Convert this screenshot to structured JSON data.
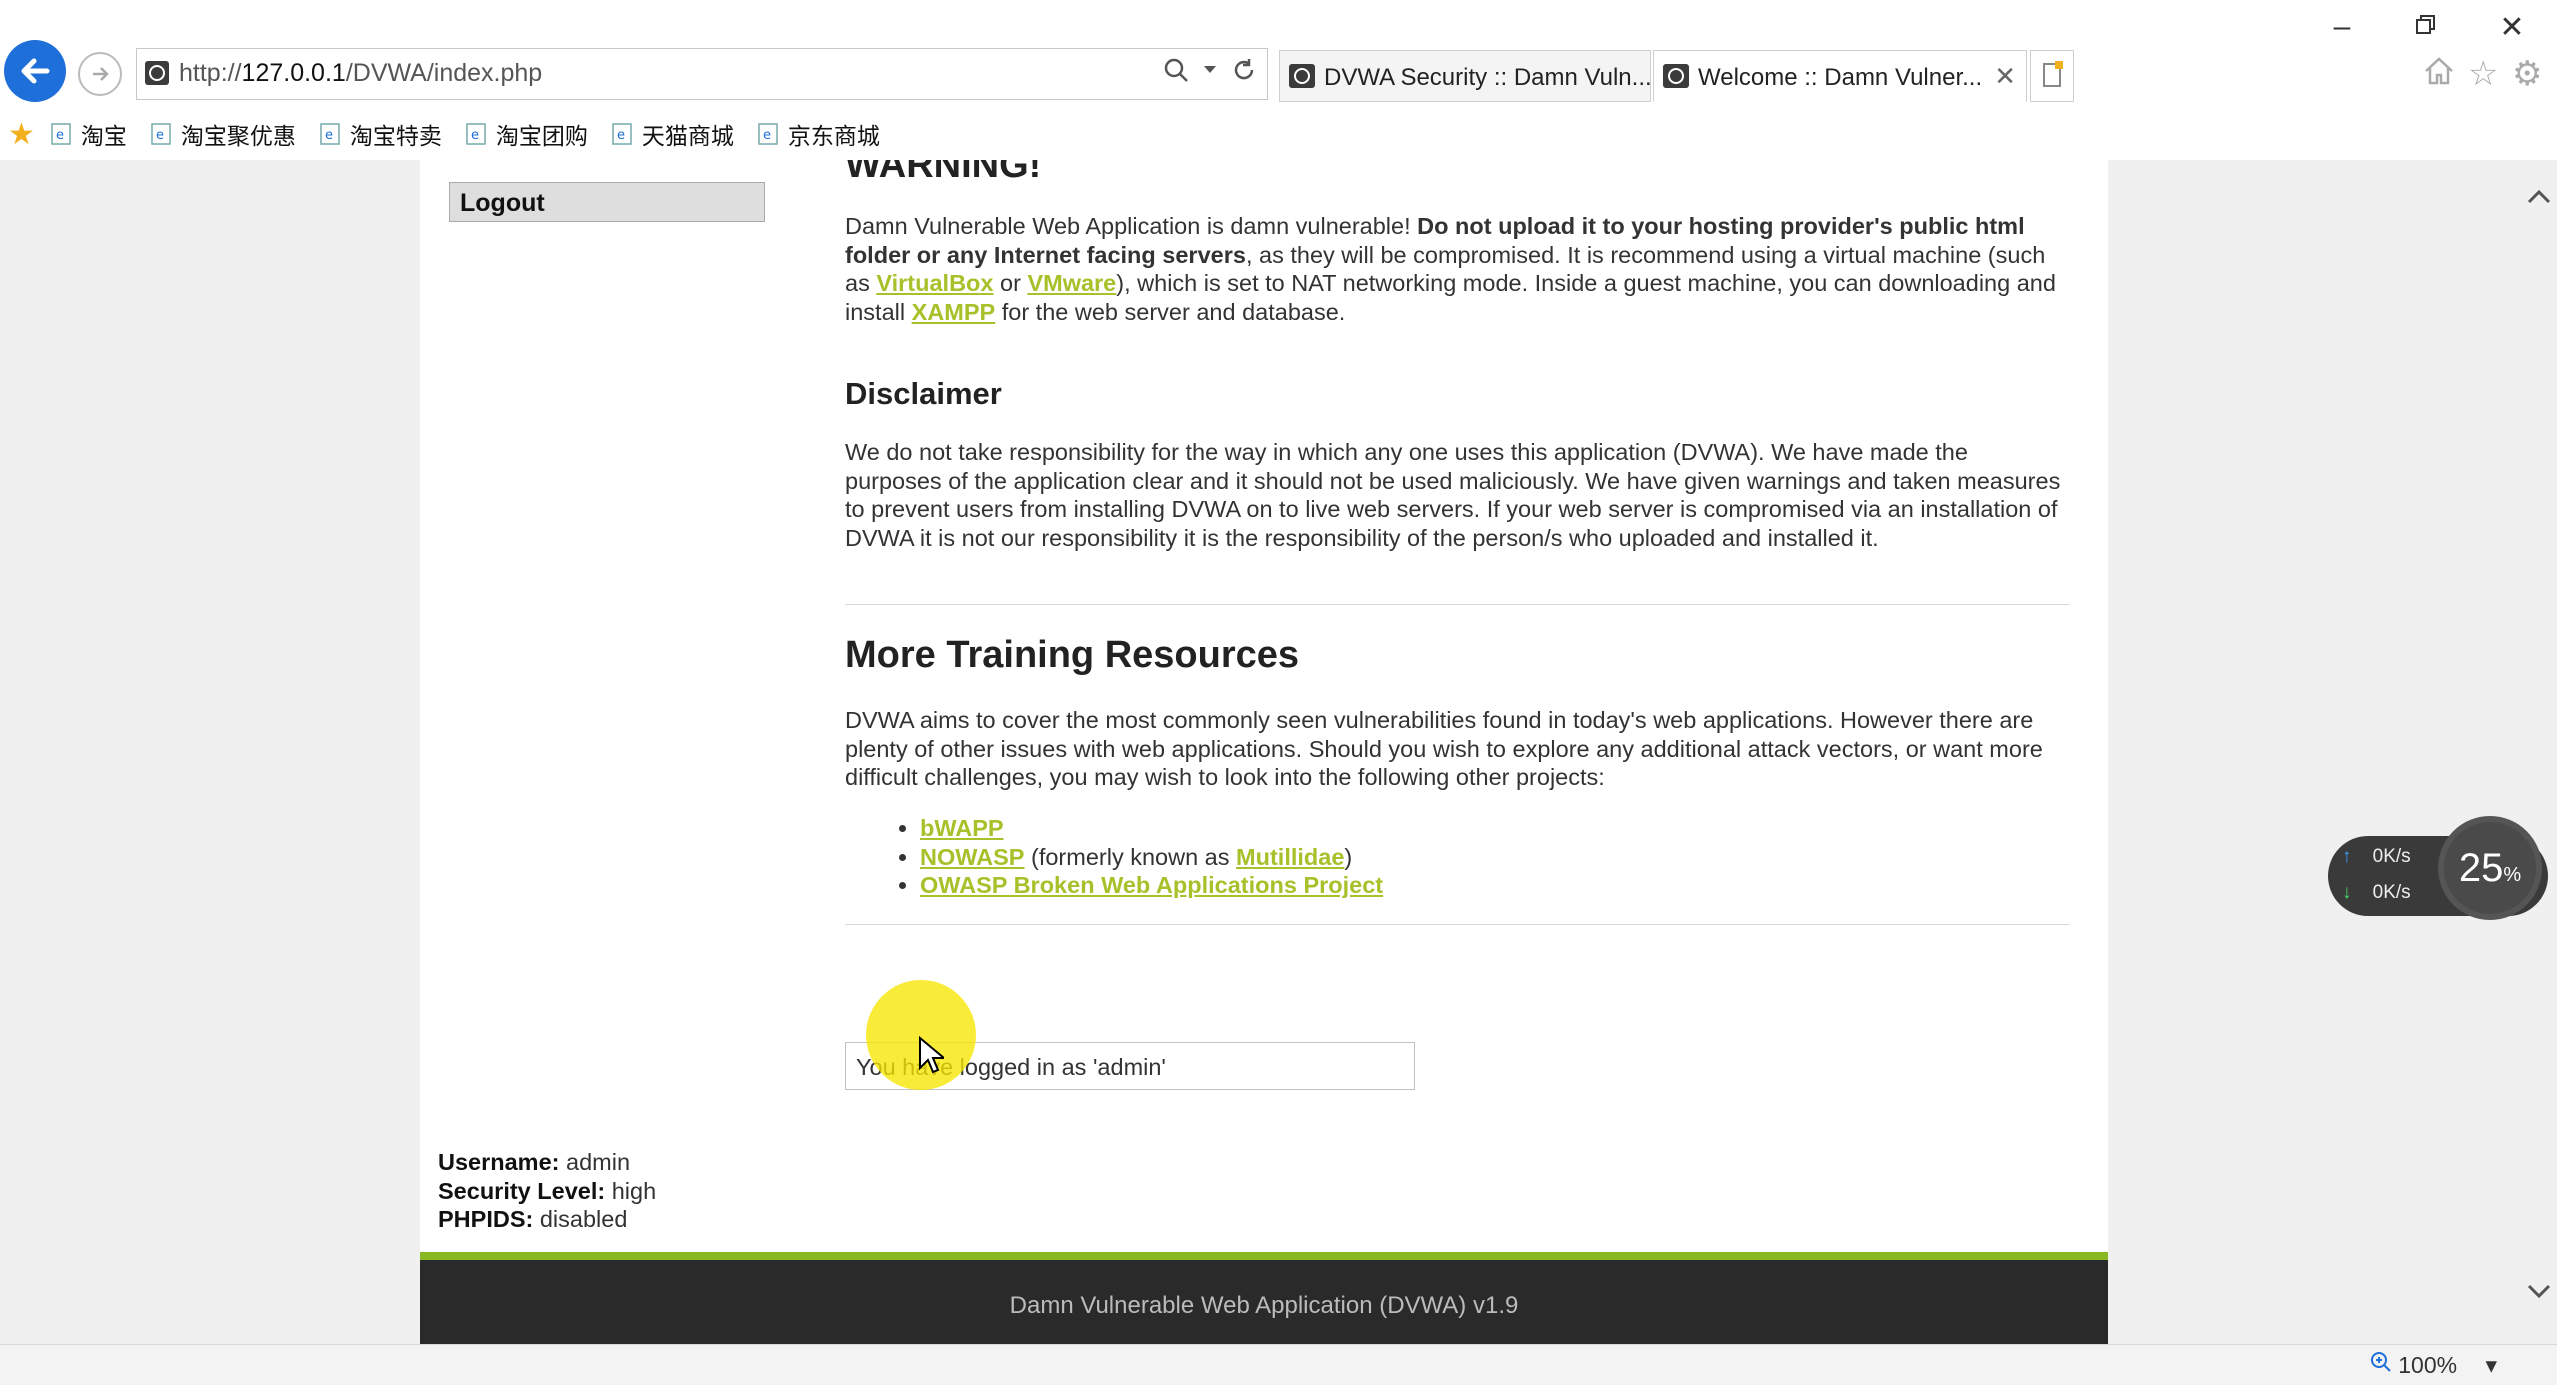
{
  "browser": {
    "url_prefix": "http://",
    "url_host": "127.0.0.1",
    "url_path": "/DVWA/index.php",
    "tabs": [
      {
        "label": "DVWA Security :: Damn Vuln..."
      },
      {
        "label": "Welcome :: Damn Vulner..."
      }
    ],
    "favorites": [
      "淘宝",
      "淘宝聚优惠",
      "淘宝特卖",
      "淘宝团购",
      "天猫商城",
      "京东商城"
    ],
    "zoom": "100%"
  },
  "sidebar": {
    "logout_label": "Logout",
    "username_label": "Username:",
    "username": "admin",
    "security_label": "Security Level:",
    "security": "high",
    "phpids_label": "PHPIDS:",
    "phpids": "disabled"
  },
  "main": {
    "warning_heading": "WARNING!",
    "warning_text_1": "Damn Vulnerable Web Application is damn vulnerable! ",
    "warning_bold": "Do not upload it to your hosting provider's public html folder or any Internet facing servers",
    "warning_text_2": ", as they will be compromised. It is recommend using a virtual machine (such as ",
    "link_virtualbox": "VirtualBox",
    "warning_or": " or ",
    "link_vmware": "VMware",
    "warning_text_3": "), which is set to NAT networking mode. Inside a guest machine, you can downloading and install ",
    "link_xampp": "XAMPP",
    "warning_text_4": " for the web server and database.",
    "disclaimer_heading": "Disclaimer",
    "disclaimer_text": "We do not take responsibility for the way in which any one uses this application (DVWA). We have made the purposes of the application clear and it should not be used maliciously. We have given warnings and taken measures to prevent users from installing DVWA on to live web servers. If your web server is compromised via an installation of DVWA it is not our responsibility it is the responsibility of the person/s who uploaded and installed it.",
    "resources_heading": "More Training Resources",
    "resources_text": "DVWA aims to cover the most commonly seen vulnerabilities found in today's web applications. However there are plenty of other issues with web applications. Should you wish to explore any additional attack vectors, or want more difficult challenges, you may wish to look into the following other projects:",
    "res_bwapp": "bWAPP",
    "res_nowasp": "NOWASP",
    "res_formerly": " (formerly known as ",
    "res_mutillidae": "Mutillidae",
    "res_close": ")",
    "res_owasp": "OWASP Broken Web Applications Project",
    "logged_in_msg": "You have logged in as 'admin'"
  },
  "footer": {
    "text": "Damn Vulnerable Web Application (DVWA) v1.9"
  },
  "net_widget": {
    "up": "0K/s",
    "down": "0K/s",
    "cpu": "25",
    "cpu_unit": "%"
  }
}
